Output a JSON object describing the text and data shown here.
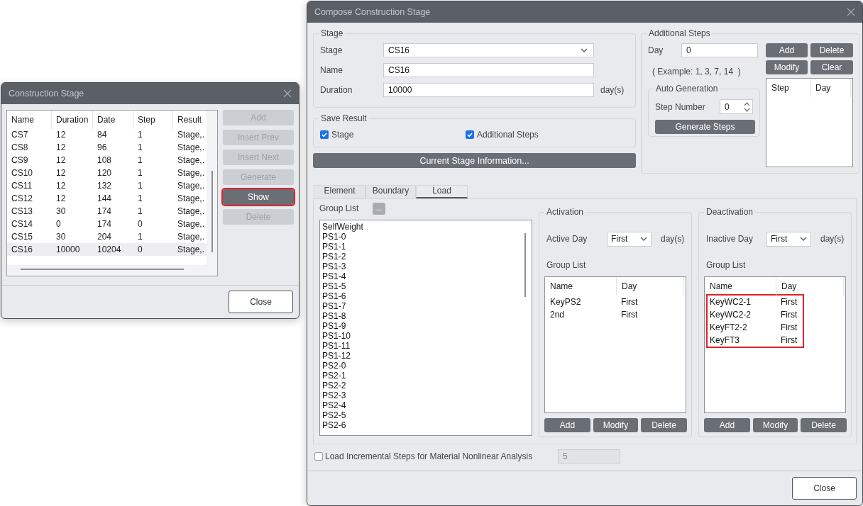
{
  "construction_stage": {
    "title": "Construction Stage",
    "columns": [
      "Name",
      "Duration",
      "Date",
      "Step",
      "Result"
    ],
    "rows": [
      {
        "cells": [
          "CS7",
          "12",
          "84",
          "1",
          "Stage,."
        ],
        "selected": false
      },
      {
        "cells": [
          "CS8",
          "12",
          "96",
          "1",
          "Stage,."
        ],
        "selected": false
      },
      {
        "cells": [
          "CS9",
          "12",
          "108",
          "1",
          "Stage,."
        ],
        "selected": false
      },
      {
        "cells": [
          "CS10",
          "12",
          "120",
          "1",
          "Stage,."
        ],
        "selected": false
      },
      {
        "cells": [
          "CS11",
          "12",
          "132",
          "1",
          "Stage,."
        ],
        "selected": false
      },
      {
        "cells": [
          "CS12",
          "12",
          "144",
          "1",
          "Stage,."
        ],
        "selected": false
      },
      {
        "cells": [
          "CS13",
          "30",
          "174",
          "1",
          "Stage,."
        ],
        "selected": false
      },
      {
        "cells": [
          "CS14",
          "0",
          "174",
          "0",
          "Stage,."
        ],
        "selected": false
      },
      {
        "cells": [
          "CS15",
          "30",
          "204",
          "1",
          "Stage,."
        ],
        "selected": false
      },
      {
        "cells": [
          "CS16",
          "10000",
          "10204",
          "0",
          "Stage,."
        ],
        "selected": true
      }
    ],
    "buttons": [
      {
        "label": "Add",
        "disabled": true,
        "highlighted": false
      },
      {
        "label": "Insert Prev",
        "disabled": true,
        "highlighted": false
      },
      {
        "label": "Insert Next",
        "disabled": true,
        "highlighted": false
      },
      {
        "label": "Generate",
        "disabled": true,
        "highlighted": false
      },
      {
        "label": "Show",
        "disabled": false,
        "highlighted": true
      },
      {
        "label": "Delete",
        "disabled": true,
        "highlighted": false
      }
    ],
    "close": "Close"
  },
  "compose": {
    "title": "Compose Construction Stage",
    "stage_group": {
      "legend": "Stage",
      "fields": [
        {
          "kind": "select",
          "label": "Stage",
          "value": "CS16"
        },
        {
          "kind": "text",
          "label": "Name",
          "value": "CS16"
        },
        {
          "kind": "text",
          "label": "Duration",
          "value": "10000",
          "unit": "day(s)"
        }
      ]
    },
    "save_result": {
      "legend": "Save Result",
      "options": [
        {
          "label": "Stage",
          "checked": true
        },
        {
          "label": "Additional Steps",
          "checked": true
        }
      ]
    },
    "info_button": "Current Stage Information...",
    "additional_steps": {
      "legend": "Additional Steps",
      "day_label": "Day",
      "day_value": "0",
      "example": "( Example: 1, 3, 7, 14  )",
      "buttons": [
        "Add",
        "Delete",
        "Modify",
        "Clear"
      ],
      "auto_generation": {
        "legend": "Auto Generation",
        "step_label": "Step Number",
        "step_value": "0",
        "button": "Generate Steps"
      },
      "table_columns": [
        "Step",
        "Day"
      ]
    },
    "tabs": [
      {
        "label": "Element",
        "selected": false
      },
      {
        "label": "Boundary",
        "selected": false
      },
      {
        "label": "Load",
        "selected": true
      }
    ],
    "group_list": {
      "label": "Group List",
      "browse": "...",
      "items": [
        "SelfWeight",
        "PS1-0",
        "PS1-1",
        "PS1-2",
        "PS1-3",
        "PS1-4",
        "PS1-5",
        "PS1-6",
        "PS1-7",
        "PS1-8",
        "PS1-9",
        "PS1-10",
        "PS1-11",
        "PS1-12",
        "PS2-0",
        "PS2-1",
        "PS2-2",
        "PS2-3",
        "PS2-4",
        "PS2-5",
        "PS2-6"
      ]
    },
    "panels": [
      {
        "legend": "Activation",
        "day_label": "Active Day",
        "day_value": "First",
        "unit": "day(s)",
        "list_label": "Group List",
        "columns": [
          "Name",
          "Day"
        ],
        "rows": [
          {
            "cells": [
              "KeyPS2",
              "First"
            ]
          },
          {
            "cells": [
              "2nd",
              "First"
            ]
          }
        ],
        "highlighted": false,
        "buttons": [
          "Add",
          "Modify",
          "Delete"
        ]
      },
      {
        "legend": "Deactivation",
        "day_label": "Inactive Day",
        "day_value": "First",
        "unit": "day(s)",
        "list_label": "Group List",
        "columns": [
          "Name",
          "Day"
        ],
        "rows": [
          {
            "cells": [
              "KeyWC2-1",
              "First"
            ]
          },
          {
            "cells": [
              "KeyWC2-2",
              "First"
            ]
          },
          {
            "cells": [
              "KeyFT2-2",
              "First"
            ]
          },
          {
            "cells": [
              "KeyFT3",
              "First"
            ]
          }
        ],
        "highlighted": true,
        "buttons": [
          "Add",
          "Modify",
          "Delete"
        ]
      }
    ],
    "incremental": {
      "label": "Load Incremental Steps for Material Nonlinear Analysis",
      "checked": false,
      "value": "5",
      "disabled": true
    },
    "close": "Close"
  }
}
